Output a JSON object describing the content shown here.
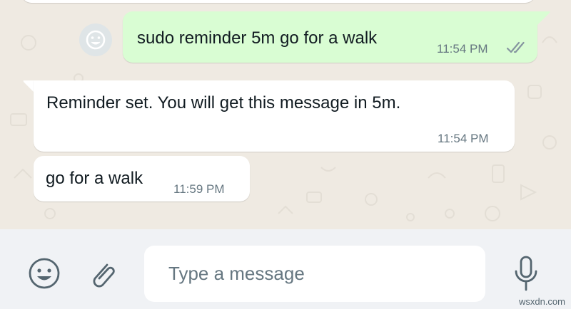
{
  "messages": [
    {
      "direction": "outgoing",
      "text": "sudo reminder 5m go for a walk",
      "time": "11:54 PM",
      "status_icon": "double-check-icon"
    },
    {
      "direction": "incoming",
      "text": "Reminder set. You will get this message in 5m.",
      "time": "11:54 PM"
    },
    {
      "direction": "incoming",
      "text": "go for a walk",
      "time": "11:59 PM"
    }
  ],
  "composer": {
    "placeholder": "Type a message",
    "value": "",
    "emoji_icon": "emoji-icon",
    "attach_icon": "paperclip-icon",
    "mic_icon": "microphone-icon"
  },
  "watermark": "wsxdn.com",
  "colors": {
    "chat_background": "#efeae2",
    "outgoing_bubble": "#d9fdd3",
    "incoming_bubble": "#ffffff",
    "composer_background": "#f0f2f5",
    "icon_gray": "#54656f",
    "timestamp_gray": "#667781"
  }
}
